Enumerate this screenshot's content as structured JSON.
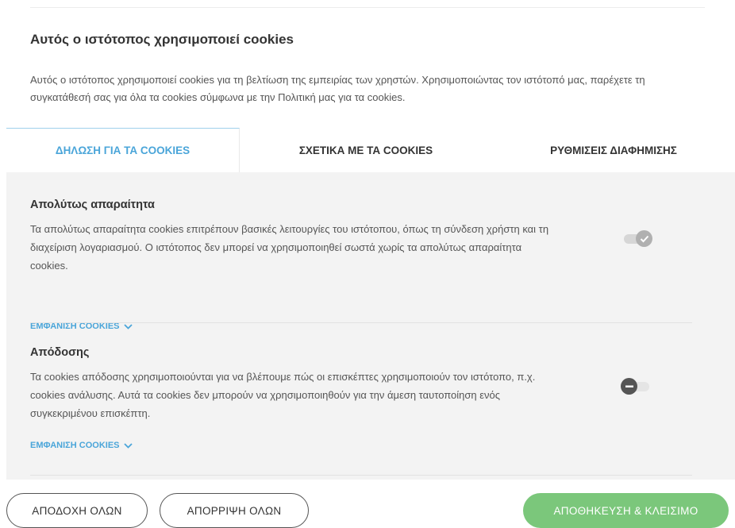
{
  "dialog": {
    "title": "Αυτός ο ιστότοπος χρησιμοποιεί cookies",
    "intro": "Αυτός ο ιστότοπος χρησιμοποιεί cookies για τη βελτίωση της εμπειρίας των χρηστών. Χρησιμοποιώντας τον ιστότοπό μας, παρέχετε τη συγκατάθεσή σας για όλα τα cookies σύμφωνα με την Πολιτική μας για τα cookies."
  },
  "tabs": [
    {
      "label": "ΔΗΛΩΣΗ ΓΙΑ ΤΑ COOKIES",
      "active": true
    },
    {
      "label": "ΣΧΕΤΙΚΑ ΜΕ ΤΑ COOKIES",
      "active": false
    },
    {
      "label": "ΡΥΘΜΙΣΕΙΣ ΔΙΑΦΗΜΙΣΗΣ",
      "active": false
    }
  ],
  "categories": [
    {
      "title": "Απολύτως απαραίτητα",
      "description": "Τα απολύτως απαραίτητα cookies επιτρέπουν βασικές λειτουργίες του ιστότοπου, όπως τη σύνδεση χρήστη και τη διαχείριση λογαριασμού. Ο ιστότοπος δεν μπορεί να χρησιμοποιηθεί σωστά χωρίς τα απολύτως απαραίτητα cookies.",
      "show_cookies_label": "ΕΜΦΑΝΙΣΗ COOKIES",
      "toggle": {
        "state": "on",
        "disabled": true,
        "icon": "check-icon"
      }
    },
    {
      "title": "Απόδοσης",
      "description": "Τα cookies απόδοσης χρησιμοποιούνται για να βλέπουμε πώς οι επισκέπτες χρησιμοποιούν τον ιστότοπο, π.χ. cookies ανάλυσης. Αυτά τα cookies δεν μπορούν να χρησιμοποιηθούν για την άμεση ταυτοποίηση ενός συγκεκριμένου επισκέπτη.",
      "show_cookies_label": "ΕΜΦΑΝΙΣΗ COOKIES",
      "toggle": {
        "state": "off",
        "disabled": false,
        "icon": "minus-icon"
      }
    }
  ],
  "footer": {
    "accept_all": "ΑΠΟΔΟΧΗ ΟΛΩΝ",
    "reject_all": "ΑΠΟΡΡΙΨΗ ΟΛΩΝ",
    "save_close": "ΑΠΟΘΗΚΕΥΣΗ & ΚΛΕΙΣΙΜΟ"
  },
  "colors": {
    "accent": "#4aa5d9",
    "save_button": "#7bc77b",
    "panel_background": "#f3f3f3"
  }
}
